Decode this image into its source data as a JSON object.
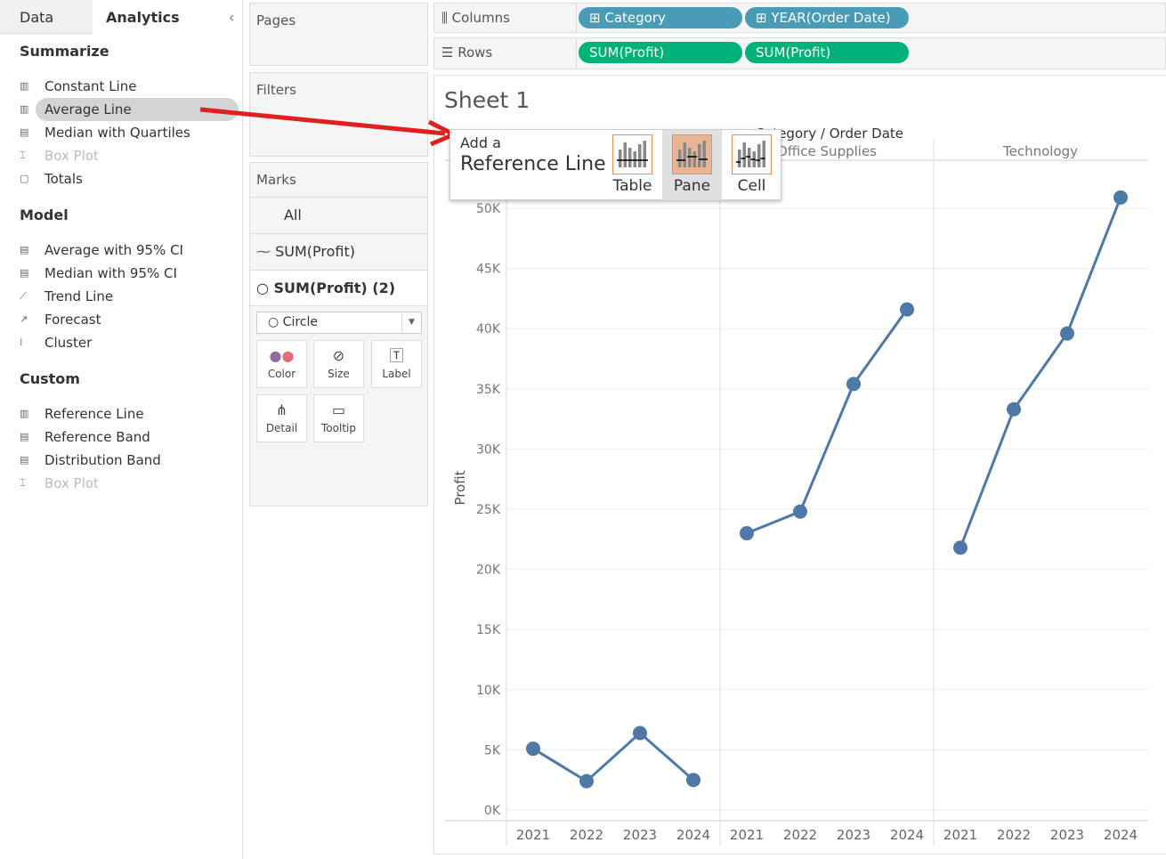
{
  "left_panel": {
    "tabs": [
      "Data",
      "Analytics"
    ],
    "collapse_icon": "chevron-left-icon",
    "sections": [
      {
        "title": "Summarize",
        "items": [
          {
            "label": "Constant Line",
            "icon": "reference-line-icon"
          },
          {
            "label": "Average Line",
            "icon": "reference-line-icon",
            "selected": true
          },
          {
            "label": "Median with Quartiles",
            "icon": "band-icon"
          },
          {
            "label": "Box Plot",
            "icon": "box-plot-icon",
            "disabled": true
          },
          {
            "label": "Totals",
            "icon": "totals-icon"
          }
        ]
      },
      {
        "title": "Model",
        "items": [
          {
            "label": "Average with 95% CI",
            "icon": "band-icon"
          },
          {
            "label": "Median with 95% CI",
            "icon": "band-icon"
          },
          {
            "label": "Trend Line",
            "icon": "trend-icon"
          },
          {
            "label": "Forecast",
            "icon": "forecast-icon"
          },
          {
            "label": "Cluster",
            "icon": "cluster-icon"
          }
        ]
      },
      {
        "title": "Custom",
        "items": [
          {
            "label": "Reference Line",
            "icon": "reference-line-icon"
          },
          {
            "label": "Reference Band",
            "icon": "band-icon"
          },
          {
            "label": "Distribution Band",
            "icon": "band-icon"
          },
          {
            "label": "Box Plot",
            "icon": "box-plot-icon",
            "disabled": true
          }
        ]
      }
    ]
  },
  "cards": {
    "pages": "Pages",
    "filters": "Filters",
    "marks": "Marks",
    "marks_rows": [
      "All",
      "SUM(Profit)",
      "SUM(Profit) (2)"
    ],
    "mark_type": "Circle",
    "buttons": [
      "Color",
      "Size",
      "Label",
      "Detail",
      "Tooltip"
    ]
  },
  "shelves": {
    "columns_label": "Columns",
    "rows_label": "Rows",
    "columns": [
      "Category",
      "YEAR(Order Date)"
    ],
    "rows": [
      "SUM(Profit)",
      "SUM(Profit)"
    ],
    "columns_color": "#4a9bb5",
    "rows_color": "#00b17a"
  },
  "sheet_title": "Sheet 1",
  "popup": {
    "line1": "Add a",
    "line2": "Reference Line",
    "options": [
      "Table",
      "Pane",
      "Cell"
    ],
    "selected": "Pane",
    "accent": "#e8915a"
  },
  "chart_data": {
    "type": "line",
    "header": "Category / Order Date",
    "ylabel": "Profit",
    "ylim": [
      0,
      52000
    ],
    "yticks": [
      "0K",
      "5K",
      "10K",
      "15K",
      "20K",
      "25K",
      "30K",
      "35K",
      "40K",
      "45K",
      "50K"
    ],
    "panes": [
      {
        "category": "",
        "years": [
          "2021",
          "2022",
          "2023",
          "2024"
        ],
        "values": [
          5100,
          2400,
          6400,
          2500
        ]
      },
      {
        "category": "Office Supplies",
        "years": [
          "2021",
          "2022",
          "2023",
          "2024"
        ],
        "values": [
          23000,
          24800,
          35400,
          41600
        ]
      },
      {
        "category": "Technology",
        "years": [
          "2021",
          "2022",
          "2023",
          "2024"
        ],
        "values": [
          21800,
          33300,
          39600,
          50900
        ]
      }
    ],
    "line_color": "#4e79a7",
    "grid": true
  }
}
